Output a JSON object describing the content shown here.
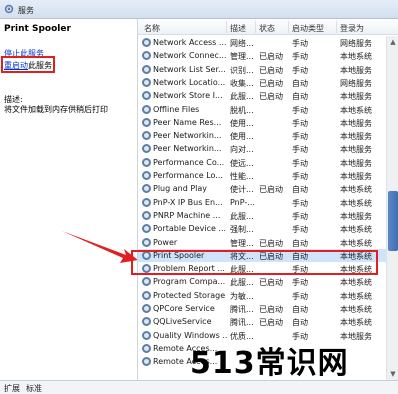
{
  "window": {
    "title": "服务"
  },
  "left": {
    "service_name": "Print Spooler",
    "stop_link": "停止此服务",
    "restart_link_part": "重启动",
    "restart_suffix": "此服务",
    "desc_label": "描述:",
    "desc_text": "将文件加载到内存供稍后打印"
  },
  "columns": {
    "name": "名称",
    "desc": "描述",
    "status": "状态",
    "startup": "启动类型",
    "logon": "登录为"
  },
  "rows": [
    {
      "name": "Network Access ...",
      "desc": "网络...",
      "status": "",
      "startup": "手动",
      "logon": "网络服务"
    },
    {
      "name": "Network Connec...",
      "desc": "管理...",
      "status": "已启动",
      "startup": "手动",
      "logon": "本地系统"
    },
    {
      "name": "Network List Ser...",
      "desc": "识别...",
      "status": "已启动",
      "startup": "手动",
      "logon": "本地服务"
    },
    {
      "name": "Network Locatio...",
      "desc": "收集...",
      "status": "已启动",
      "startup": "自动",
      "logon": "网络服务"
    },
    {
      "name": "Network Store I...",
      "desc": "此服...",
      "status": "已启动",
      "startup": "自动",
      "logon": "本地服务"
    },
    {
      "name": "Offline Files",
      "desc": "脱机...",
      "status": "",
      "startup": "手动",
      "logon": "本地系统"
    },
    {
      "name": "Peer Name Res...",
      "desc": "使用...",
      "status": "",
      "startup": "手动",
      "logon": "本地服务"
    },
    {
      "name": "Peer Networkin...",
      "desc": "使用...",
      "status": "",
      "startup": "手动",
      "logon": "本地服务"
    },
    {
      "name": "Peer Networkin...",
      "desc": "向对...",
      "status": "",
      "startup": "手动",
      "logon": "本地服务"
    },
    {
      "name": "Performance Co...",
      "desc": "使远...",
      "status": "",
      "startup": "手动",
      "logon": "本地服务"
    },
    {
      "name": "Performance Lo...",
      "desc": "性能...",
      "status": "",
      "startup": "手动",
      "logon": "本地服务"
    },
    {
      "name": "Plug and Play",
      "desc": "使计...",
      "status": "已启动",
      "startup": "自动",
      "logon": "本地系统"
    },
    {
      "name": "PnP-X IP Bus En...",
      "desc": "PnP-...",
      "status": "",
      "startup": "手动",
      "logon": "本地系统"
    },
    {
      "name": "PNRP Machine ...",
      "desc": "此服...",
      "status": "",
      "startup": "手动",
      "logon": "本地服务"
    },
    {
      "name": "Portable Device ...",
      "desc": "强制...",
      "status": "",
      "startup": "手动",
      "logon": "本地系统"
    },
    {
      "name": "Power",
      "desc": "管理...",
      "status": "已启动",
      "startup": "自动",
      "logon": "本地系统"
    },
    {
      "name": "Print Spooler",
      "desc": "将文...",
      "status": "已启动",
      "startup": "自动",
      "logon": "本地系统",
      "selected": true
    },
    {
      "name": "Problem Report ...",
      "desc": "此服...",
      "status": "",
      "startup": "手动",
      "logon": "本地系统"
    },
    {
      "name": "Program Compa...",
      "desc": "此服...",
      "status": "已启动",
      "startup": "手动",
      "logon": "本地系统"
    },
    {
      "name": "Protected Storage",
      "desc": "为敏...",
      "status": "",
      "startup": "手动",
      "logon": "本地系统"
    },
    {
      "name": "QPCore Service",
      "desc": "腾讯...",
      "status": "已启动",
      "startup": "自动",
      "logon": "本地系统"
    },
    {
      "name": "QQLiveService",
      "desc": "腾讯...",
      "status": "已启动",
      "startup": "自动",
      "logon": "本地系统"
    },
    {
      "name": "Quality Windows ...",
      "desc": "优质...",
      "status": "",
      "startup": "手动",
      "logon": "本地服务"
    },
    {
      "name": "Remote Acces...",
      "desc": "",
      "status": "",
      "startup": "",
      "logon": ""
    },
    {
      "name": "Remote Acces...",
      "desc": "",
      "status": "",
      "startup": "",
      "logon": ""
    }
  ],
  "tabs": {
    "extended": "扩展",
    "standard": "标准"
  },
  "watermark": "513常识网",
  "colors": {
    "highlight": "#e02020",
    "selection": "#cfe3fb",
    "link": "#0033cc"
  }
}
